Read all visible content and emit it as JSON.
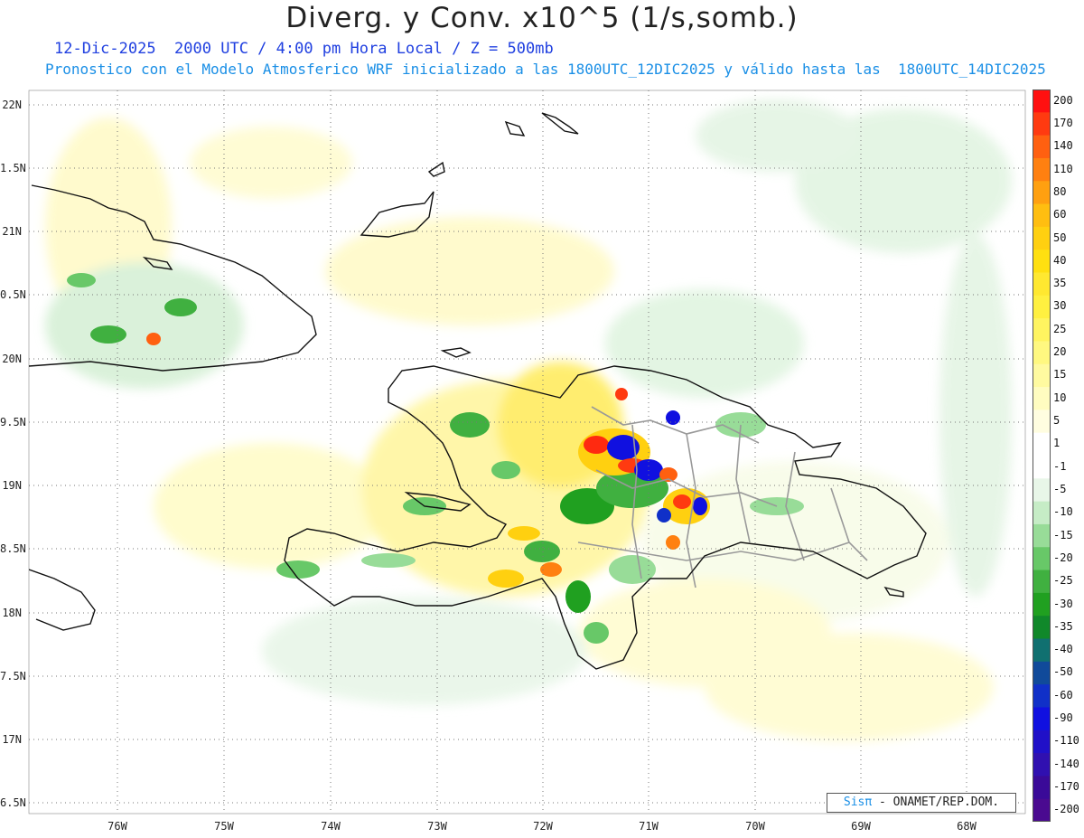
{
  "header": {
    "title": "Diverg. y Conv. x10^5 (1/s,somb.)",
    "subtitle1": "12-Dic-2025  2000 UTC / 4:00 pm Hora Local / Z = 500mb",
    "subtitle2": "Pronostico con el Modelo Atmosferico WRF inicializado a las 1800UTC_12DIC2025 y válido hasta las  1800UTC_14DIC2025"
  },
  "axes": {
    "lat_labels": [
      "22N",
      "1.5N",
      "21N",
      "0.5N",
      "20N",
      "9.5N",
      "19N",
      "8.5N",
      "18N",
      "7.5N",
      "17N",
      "6.5N"
    ],
    "lon_labels": [
      "76W",
      "75W",
      "74W",
      "73W",
      "72W",
      "71W",
      "70W",
      "69W",
      "68W"
    ]
  },
  "colorbar": {
    "labels": [
      "200",
      "170",
      "140",
      "110",
      "80",
      "60",
      "50",
      "40",
      "35",
      "30",
      "25",
      "20",
      "15",
      "10",
      "5",
      "1",
      "-1",
      "-5",
      "-10",
      "-15",
      "-20",
      "-25",
      "-30",
      "-35",
      "-40",
      "-50",
      "-60",
      "-90",
      "-110",
      "-140",
      "-170",
      "-200"
    ],
    "colors": [
      "#ff1010",
      "#ff3a10",
      "#ff6010",
      "#ff8010",
      "#ffa010",
      "#ffbe10",
      "#ffd010",
      "#ffe010",
      "#ffe830",
      "#fff040",
      "#fff460",
      "#fff880",
      "#fffaa0",
      "#fffcc0",
      "#fffde0",
      "#ffffff",
      "#ffffff",
      "#e8f6e8",
      "#c6ecc6",
      "#98dc98",
      "#68c868",
      "#40b040",
      "#20a020",
      "#10882a",
      "#107070",
      "#104a9a",
      "#1030c8",
      "#1010e0",
      "#2010c8",
      "#3010b0",
      "#3a0a98",
      "#4a0a90"
    ]
  },
  "brand": {
    "sis": "Sisπ",
    "text": " - ONAMET/REP.DOM."
  }
}
